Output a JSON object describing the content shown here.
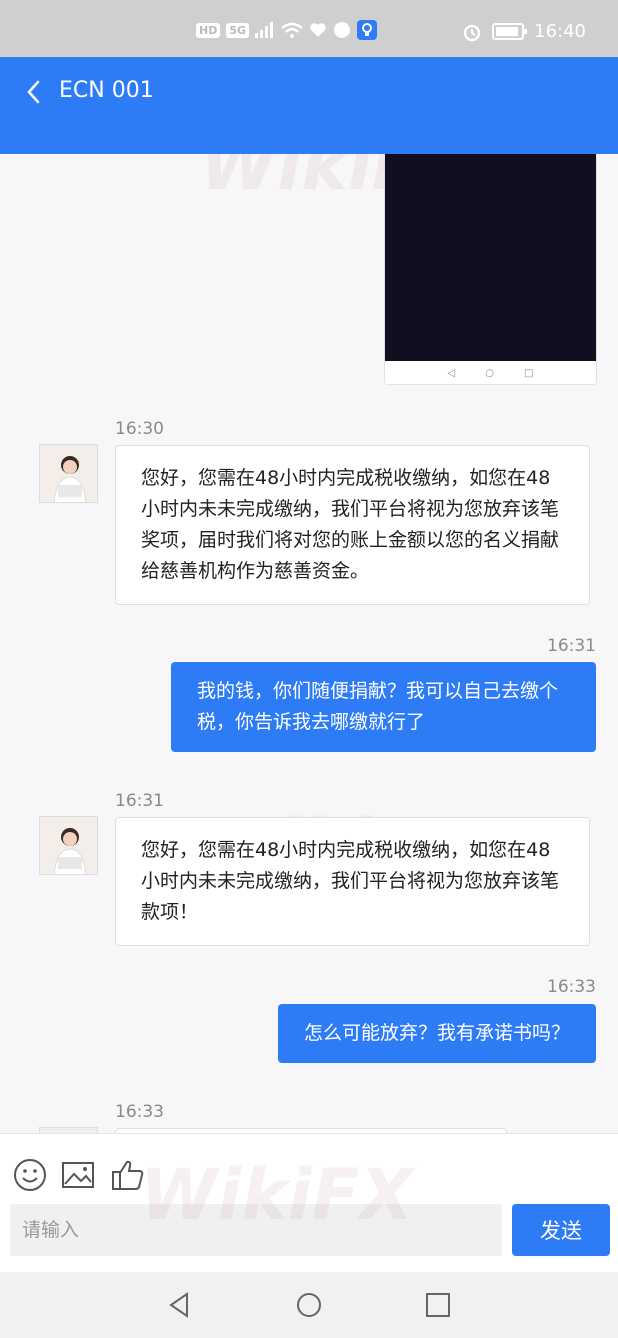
{
  "status_bar": {
    "left_chips": [
      "HD",
      "5G"
    ],
    "time": "16:40"
  },
  "header": {
    "title": "ECN 001"
  },
  "messages": [
    {
      "time": "16:30",
      "direction": "incoming",
      "text": "您好，您需在48小时内完成税收缴纳，如您在48小时内未未完成缴纳，我们平台将视为您放弃该笔奖项，届时我们将对您的账上金额以您的名义捐献给慈善机构作为慈善资金。"
    },
    {
      "time": "16:31",
      "direction": "outgoing",
      "text": "我的钱，你们随便捐献？我可以自己去缴个税，你告诉我去哪缴就行了"
    },
    {
      "time": "16:31",
      "direction": "incoming",
      "text": "您好，您需在48小时内完成税收缴纳，如您在48小时内未未完成缴纳，我们平台将视为您放弃该笔款项！"
    },
    {
      "time": "16:33",
      "direction": "outgoing",
      "text": "怎么可能放弃？我有承诺书吗？"
    },
    {
      "time": "16:33",
      "direction": "incoming",
      "text": ""
    }
  ],
  "composer": {
    "placeholder": "请输入",
    "send_label": "发送"
  },
  "watermark": "WikiFX",
  "colors": {
    "accent": "#2d7cf6"
  }
}
